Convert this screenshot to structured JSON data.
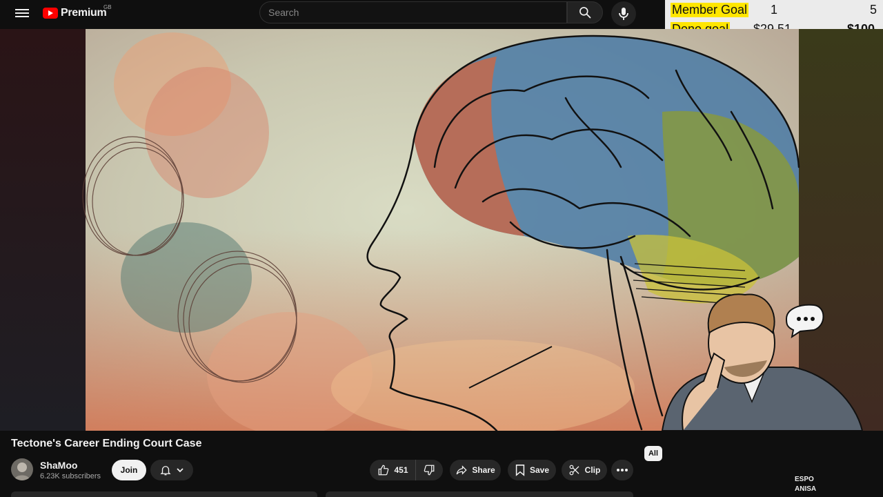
{
  "header": {
    "logo_text": "Premium",
    "region": "GB",
    "search_placeholder": "Search",
    "icons": [
      "menu-icon",
      "search-icon",
      "mic-icon"
    ]
  },
  "overlay": {
    "member_goal_label": "Member Goal",
    "member_goal_current": "1",
    "member_goal_target": "5",
    "dono_goal_label": "Dono goal",
    "dono_goal_current": "$29.51",
    "dono_goal_target": "$100"
  },
  "video": {
    "title": "Tectone's Career Ending Court Case"
  },
  "channel": {
    "name": "ShaMoo",
    "subscribers": "6.23K subscribers",
    "join_label": "Join"
  },
  "actions": {
    "likes": "451",
    "share_label": "Share",
    "save_label": "Save",
    "clip_label": "Clip"
  },
  "sidebar": {
    "chip_all": "All",
    "partial_text_1": "ESPO",
    "partial_text_2": "ANISA"
  },
  "colors": {
    "background": "#0f0f0f",
    "accent_red": "#ff0000",
    "goal_highlight": "#ffe600",
    "pill_bg": "#272727"
  }
}
